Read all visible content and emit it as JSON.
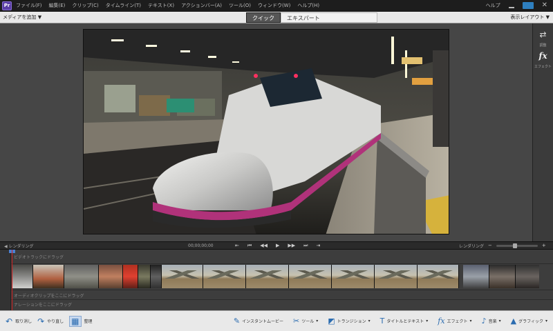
{
  "menubar": {
    "items": [
      "ファイル(F)",
      "編集(E)",
      "クリップ(C)",
      "タイムライン(T)",
      "テキスト(X)",
      "アクションバー(A)",
      "ツール(O)",
      "ウィンドウ(W)",
      "ヘルプ(H)"
    ],
    "help_link": "ヘルプ"
  },
  "modebar": {
    "media_label": "メディアを追加 ▼",
    "tabs": [
      "クイック",
      "エキスパート"
    ],
    "layout_label": "表示レイアウト ▼"
  },
  "right_panel": {
    "adjust_label": "調整",
    "fx_label": "エフェクト"
  },
  "transport": {
    "left_label": "◀ レンダリング",
    "timecode": "00;00;00;00",
    "render_label": "レンダリング"
  },
  "timeline": {
    "video_track_label": "ビデオトラックにドラッグ",
    "audio_track_label": "オーディオクリップをここにドラッグ",
    "narration_label": "ナレーションをここにドラッグ"
  },
  "toolbar": {
    "undo": "取り消し",
    "redo": "やり直し",
    "organizer": "整理",
    "instant_movie": "インスタントムービー",
    "tools": "ツール",
    "transitions": "トランジション",
    "titles": "タイトルとテキスト",
    "effects": "エフェクト",
    "music": "音楽",
    "graphics": "グラフィック"
  },
  "colors": {
    "accent_blue": "#2b6cb0",
    "playhead_red": "#d02020"
  }
}
